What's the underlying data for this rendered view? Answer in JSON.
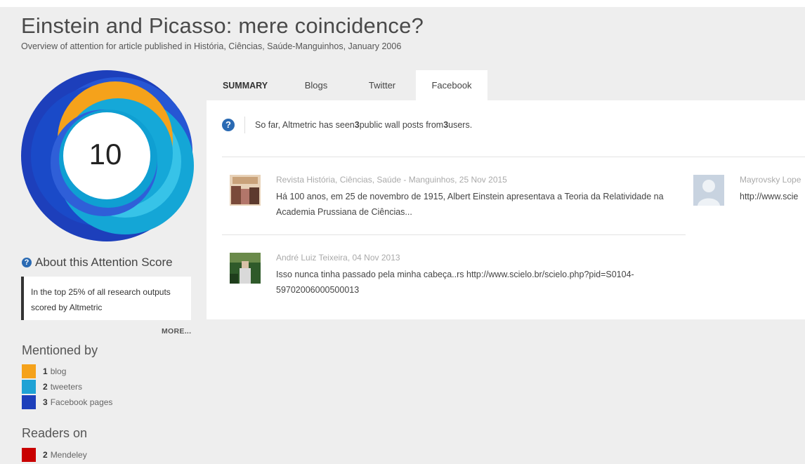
{
  "article": {
    "title": "Einstein and Picasso: mere coincidence?",
    "subtitle": "Overview of attention for article published in História, Ciências, Saúde-Manguinhos, January 2006"
  },
  "score": {
    "value": "10",
    "about_label": "About this Attention Score",
    "summary": "In the top 25% of all research outputs scored by Altmetric",
    "more_label": "MORE..."
  },
  "colors": {
    "blog": "#f5a21b",
    "tweeters": "#1fa2d5",
    "facebook": "#1d3fbb",
    "mendeley": "#c90000",
    "accent": "#2a6ab3"
  },
  "mentioned_by": {
    "heading": "Mentioned by",
    "items": [
      {
        "count": "1",
        "label": "blog",
        "icon": "blog-swatch"
      },
      {
        "count": "2",
        "label": "tweeters",
        "icon": "twitter-swatch"
      },
      {
        "count": "3",
        "label": "Facebook pages",
        "icon": "facebook-swatch"
      }
    ]
  },
  "readers_on": {
    "heading": "Readers on",
    "items": [
      {
        "count": "2",
        "label": "Mendeley",
        "icon": "mendeley-swatch"
      }
    ]
  },
  "tabs": [
    {
      "label": "SUMMARY",
      "active": false
    },
    {
      "label": "Blogs",
      "active": false
    },
    {
      "label": "Twitter",
      "active": false
    },
    {
      "label": "Facebook",
      "active": true
    }
  ],
  "facebook_panel": {
    "intro_prefix": "So far, Altmetric has seen ",
    "posts_count": "3",
    "intro_middle": " public wall posts from ",
    "users_count": "3",
    "intro_suffix": " users.",
    "posts": [
      {
        "author_date": "Revista História, Ciências, Saúde - Manguinhos, 25 Nov 2015",
        "text": "Há 100 anos, em 25 de novembro de 1915, Albert Einstein apresentava a Teoria da Relatividade na Academia Prussiana de Ciências..."
      },
      {
        "author_date": "André Luiz Teixeira, 04 Nov 2013",
        "text": "Isso nunca tinha passado pela minha cabeça..rs http://www.scielo.br/scielo.php?pid=S0104-59702006000500013"
      },
      {
        "author_date": "Mayrovsky Lope",
        "text": "http://www.scie"
      }
    ]
  }
}
